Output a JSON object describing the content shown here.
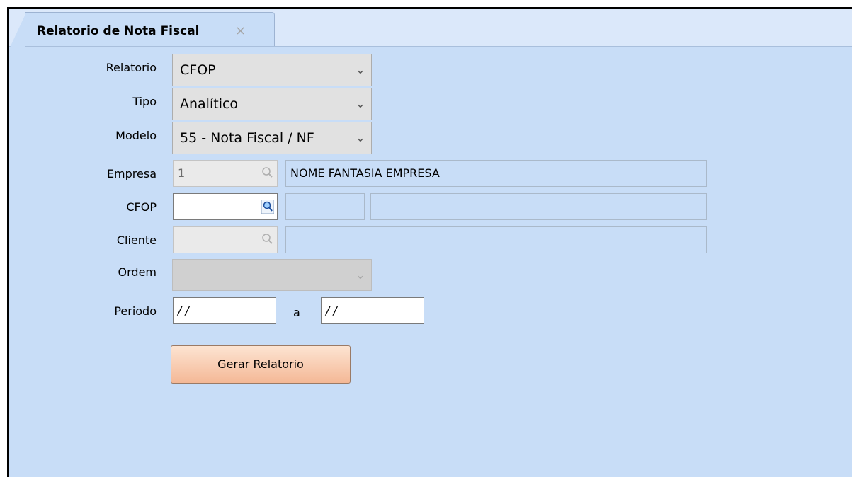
{
  "tab": {
    "title": "Relatorio de Nota Fiscal",
    "close_glyph": "×"
  },
  "form": {
    "relatorio": {
      "label": "Relatorio",
      "value": "CFOP"
    },
    "tipo": {
      "label": "Tipo",
      "value": "Analítico"
    },
    "modelo": {
      "label": "Modelo",
      "value": "55 - Nota Fiscal / NF"
    },
    "empresa": {
      "label": "Empresa",
      "code": "1",
      "name": "NOME FANTASIA EMPRESA"
    },
    "cfop": {
      "label": "CFOP",
      "code": "",
      "desc1": "",
      "desc2": ""
    },
    "cliente": {
      "label": "Cliente",
      "code": "",
      "name": ""
    },
    "ordem": {
      "label": "Ordem",
      "value": ""
    },
    "periodo": {
      "label": "Periodo",
      "from": " / /",
      "sep": "a",
      "to": " / /"
    }
  },
  "actions": {
    "generate_label": "Gerar Relatorio"
  },
  "icons": {
    "chevron": "chevron-down-icon",
    "lookup": "magnifier-icon"
  },
  "colors": {
    "panel_bg": "#c8ddf7",
    "button_top": "#fde4d2",
    "button_bottom": "#f4b896"
  }
}
